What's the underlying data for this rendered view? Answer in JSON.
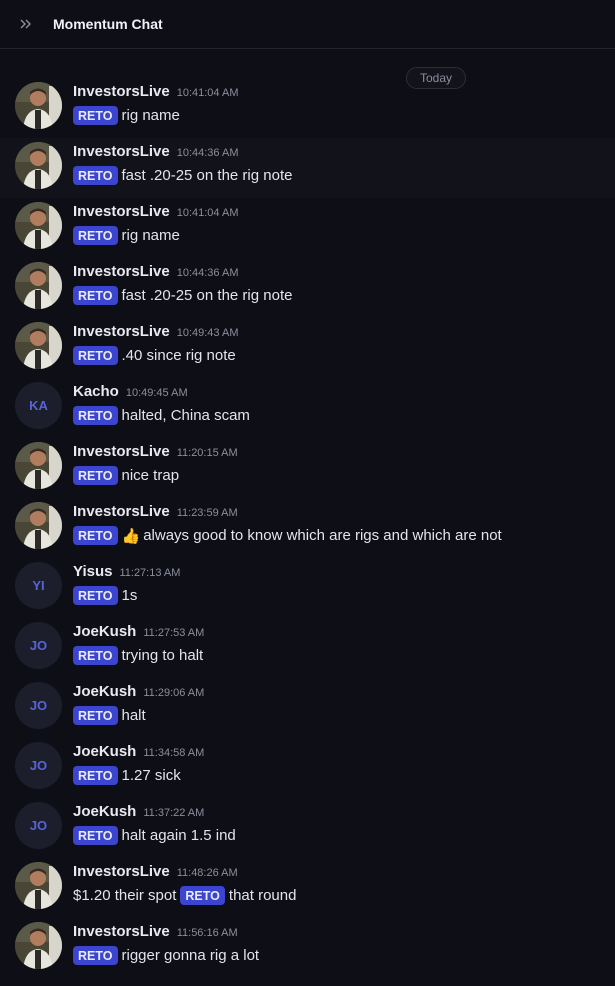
{
  "header": {
    "title": "Momentum Chat",
    "expand_icon": "double-chevron-right-icon"
  },
  "divider": {
    "label": "Today"
  },
  "badge_label": "RETO",
  "messages": [
    {
      "user": "InvestorsLive",
      "time": "10:41:04 AM",
      "avatar": "photo",
      "text": "rig name"
    },
    {
      "user": "InvestorsLive",
      "time": "10:44:36 AM",
      "avatar": "photo",
      "text": "fast .20-25 on the rig note",
      "highlight": true
    },
    {
      "user": "InvestorsLive",
      "time": "10:41:04 AM",
      "avatar": "photo",
      "text": "rig name"
    },
    {
      "user": "InvestorsLive",
      "time": "10:44:36 AM",
      "avatar": "photo",
      "text": "fast .20-25 on the rig note"
    },
    {
      "user": "InvestorsLive",
      "time": "10:49:43 AM",
      "avatar": "photo",
      "text": ".40 since rig note"
    },
    {
      "user": "Kacho",
      "time": "10:49:45 AM",
      "avatar": "KA",
      "text": "halted, China scam"
    },
    {
      "user": "InvestorsLive",
      "time": "11:20:15 AM",
      "avatar": "photo",
      "text": "nice trap"
    },
    {
      "user": "InvestorsLive",
      "time": "11:23:59 AM",
      "avatar": "photo",
      "emoji": "👍",
      "text": "always good to know which are rigs and which are not"
    },
    {
      "user": "Yisus",
      "time": "11:27:13 AM",
      "avatar": "YI",
      "text": "1s"
    },
    {
      "user": "JoeKush",
      "time": "11:27:53 AM",
      "avatar": "JO",
      "text": "trying to halt"
    },
    {
      "user": "JoeKush",
      "time": "11:29:06 AM",
      "avatar": "JO",
      "text": "halt"
    },
    {
      "user": "JoeKush",
      "time": "11:34:58 AM",
      "avatar": "JO",
      "text": " 1.27 sick"
    },
    {
      "user": "JoeKush",
      "time": "11:37:22 AM",
      "avatar": "JO",
      "text": "halt again 1.5 ind"
    },
    {
      "user": "InvestorsLive",
      "time": "11:48:26 AM",
      "avatar": "photo",
      "before": "$1.20 their spot",
      "text": "that round"
    },
    {
      "user": "InvestorsLive",
      "time": "11:56:16 AM",
      "avatar": "photo",
      "text": "rigger gonna rig a lot"
    }
  ]
}
